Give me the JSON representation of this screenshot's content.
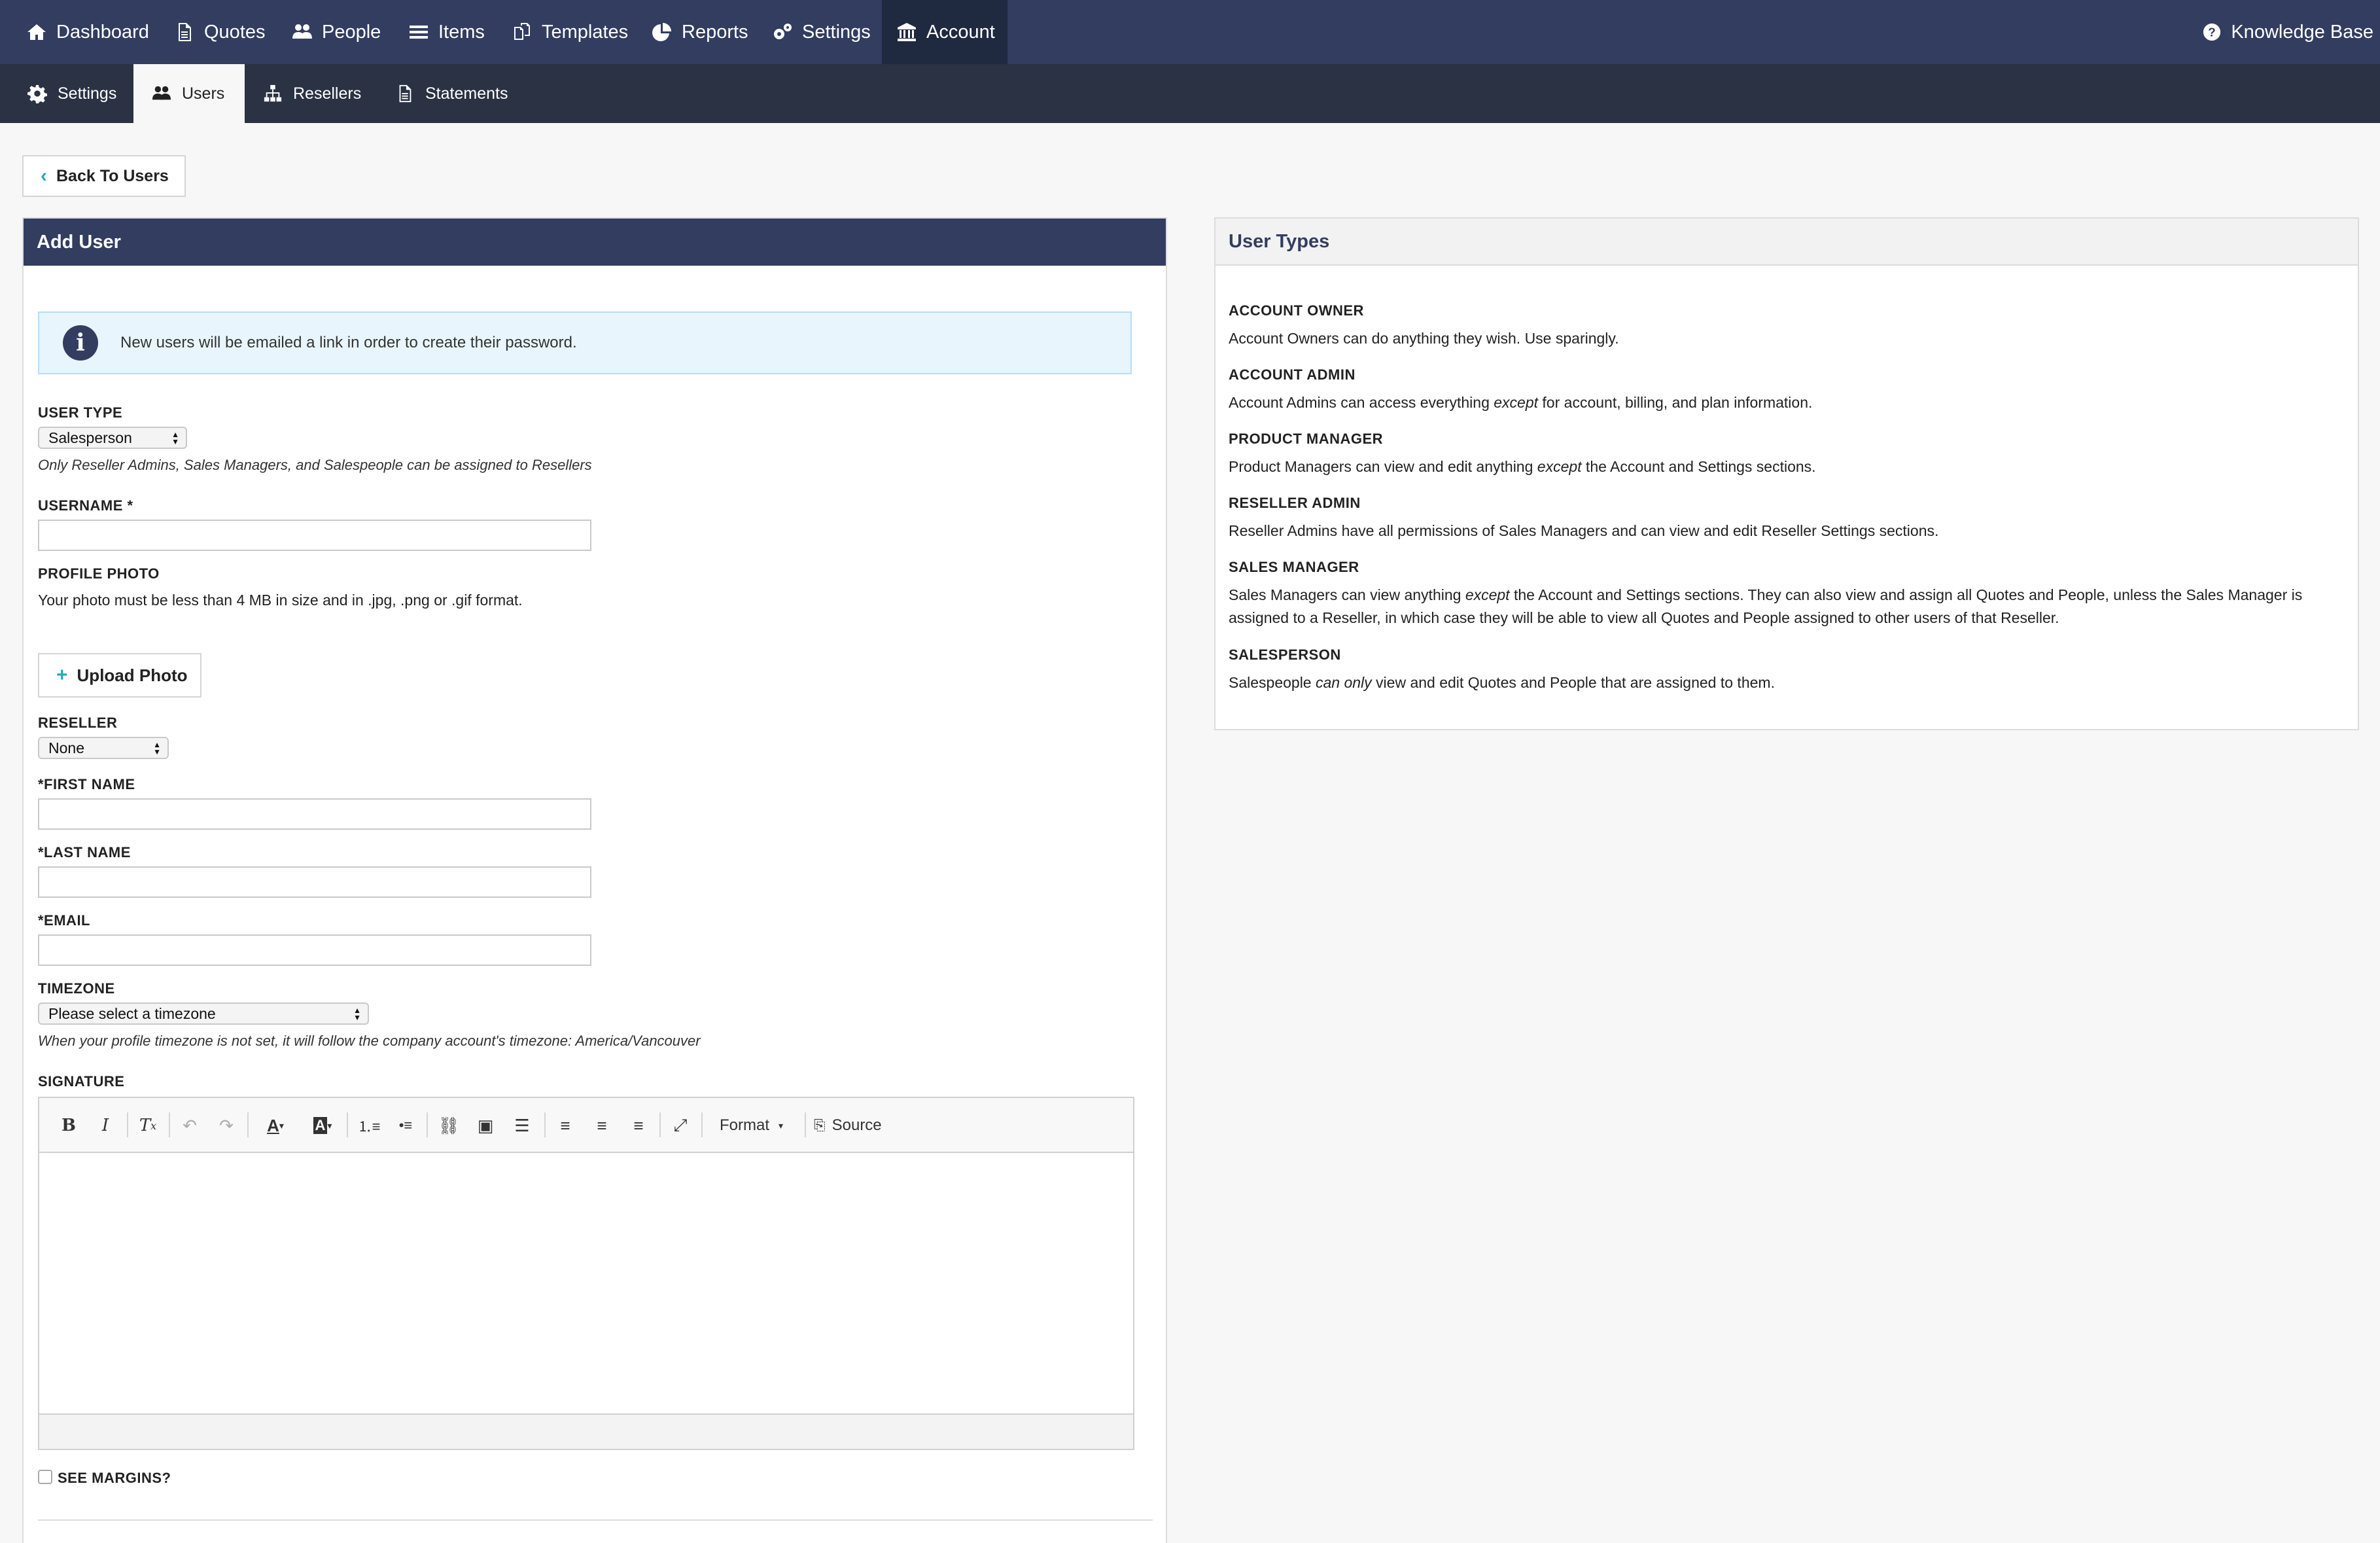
{
  "topnav": {
    "items": [
      {
        "label": "Dashboard",
        "icon": "home-icon"
      },
      {
        "label": "Quotes",
        "icon": "document-icon"
      },
      {
        "label": "People",
        "icon": "users-icon"
      },
      {
        "label": "Items",
        "icon": "list-icon"
      },
      {
        "label": "Templates",
        "icon": "templates-icon"
      },
      {
        "label": "Reports",
        "icon": "pie-chart-icon"
      },
      {
        "label": "Settings",
        "icon": "gears-icon"
      },
      {
        "label": "Account",
        "icon": "bank-icon"
      }
    ],
    "active": "Account",
    "knowledge_base": "Knowledge Base"
  },
  "subnav": {
    "items": [
      {
        "label": "Settings",
        "icon": "gear-icon"
      },
      {
        "label": "Users",
        "icon": "users-icon"
      },
      {
        "label": "Resellers",
        "icon": "sitemap-icon"
      },
      {
        "label": "Statements",
        "icon": "document-icon"
      }
    ],
    "active": "Users"
  },
  "back_button": "Back To Users",
  "form": {
    "title": "Add User",
    "info": "New users will be emailed a link in order to create their password.",
    "user_type": {
      "label": "USER TYPE",
      "value": "Salesperson",
      "hint": "Only Reseller Admins, Sales Managers, and Salespeople can be assigned to Resellers"
    },
    "username": {
      "label": "USERNAME *",
      "value": ""
    },
    "profile_photo": {
      "label": "PROFILE PHOTO",
      "hint": "Your photo must be less than 4 MB in size and in .jpg, .png or .gif format.",
      "button": "Upload Photo"
    },
    "reseller": {
      "label": "RESELLER",
      "value": "None"
    },
    "first_name": {
      "label": "*FIRST NAME",
      "value": ""
    },
    "last_name": {
      "label": "*LAST NAME",
      "value": ""
    },
    "email": {
      "label": "*EMAIL",
      "value": ""
    },
    "timezone": {
      "label": "TIMEZONE",
      "value": "Please select a timezone",
      "hint": "When your profile timezone is not set, it will follow the company account's timezone: America/Vancouver"
    },
    "signature": {
      "label": "SIGNATURE",
      "format_label": "Format",
      "source_label": "Source"
    },
    "see_margins": {
      "label": "SEE MARGINS?",
      "checked": false
    }
  },
  "user_types": {
    "title": "User Types",
    "types": [
      {
        "name": "ACCOUNT OWNER",
        "before": "Account Owners can do anything they wish. Use sparingly.",
        "em": "",
        "after": ""
      },
      {
        "name": "ACCOUNT ADMIN",
        "before": "Account Admins can access everything ",
        "em": "except",
        "after": " for account, billing, and plan information."
      },
      {
        "name": "PRODUCT MANAGER",
        "before": "Product Managers can view and edit anything ",
        "em": "except",
        "after": " the Account and Settings sections."
      },
      {
        "name": "RESELLER ADMIN",
        "before": "Reseller Admins have all permissions of Sales Managers and can view and edit Reseller Settings sections.",
        "em": "",
        "after": ""
      },
      {
        "name": "SALES MANAGER",
        "before": "Sales Managers can view anything ",
        "em": "except",
        "after": " the Account and Settings sections. They can also view and assign all Quotes and People, unless the Sales Manager is assigned to a Reseller, in which case they will be able to view all Quotes and People assigned to other users of that Reseller."
      },
      {
        "name": "SALESPERSON",
        "before": "Salespeople ",
        "em": "can only",
        "after": " view and edit Quotes and People that are assigned to them."
      }
    ]
  }
}
